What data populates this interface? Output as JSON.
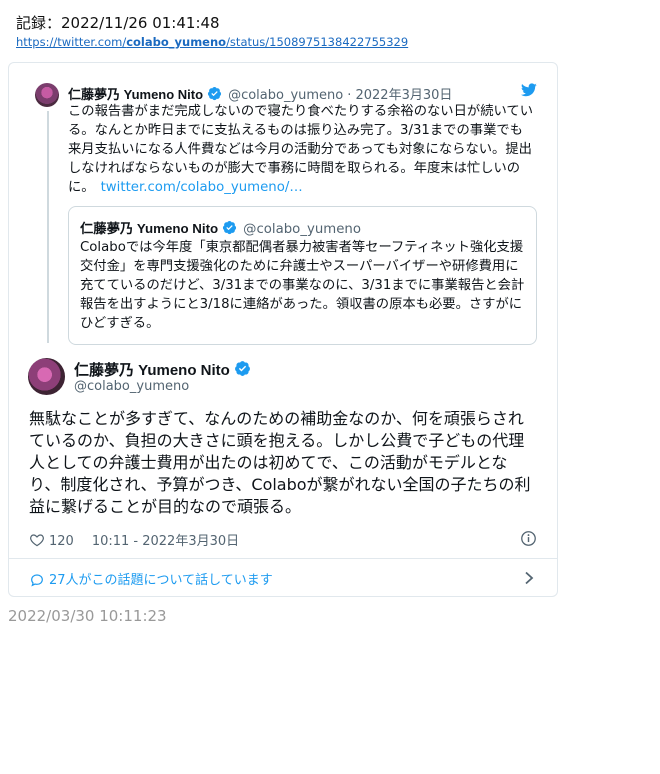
{
  "record": {
    "label": "記録：2022/11/26 01:41:48",
    "url_prefix": "https://twitter.com/",
    "url_user": "colabo_yumeno",
    "url_suffix": "/status/1508975138422755329"
  },
  "parent_tweet": {
    "name": "仁藤夢乃 Yumeno Nito",
    "handle": "@colabo_yumeno",
    "date": "· 2022年3月30日",
    "text": "この報告書がまだ完成しないので寝たり食べたりする余裕のない日が続いている。なんとか昨日までに支払えるものは振り込み完了。3/31までの事業でも来月支払いになる人件費などは今月の活動分であっても対象にならない。提出しなければならないものが膨大で事務に時間を取られる。年度末は忙しいのに。",
    "link": "twitter.com/colabo_yumeno/…"
  },
  "quoted_tweet": {
    "name": "仁藤夢乃 Yumeno Nito",
    "handle": "@colabo_yumeno",
    "text": "Colaboでは今年度「東京都配偶者暴力被害者等セーフティネット強化支援交付金」を専門支援強化のために弁護士やスーパーバイザーや研修費用に充てているのだけど、3/31までの事業なのに、3/31までに事業報告と会計報告を出すようにと3/18に連絡があった。領収書の原本も必要。さすがにひどすぎる。"
  },
  "main_tweet": {
    "name": "仁藤夢乃 Yumeno Nito",
    "handle": "@colabo_yumeno",
    "text": "無駄なことが多すぎて、なんのための補助金なのか、何を頑張らされているのか、負担の大きさに頭を抱える。しかし公費で子どもの代理人としての弁護士費用が出たのは初めてで、この活動がモデルとなり、制度化され、予算がつき、Colaboが繋がれない全国の子たちの利益に繋げることが目的なので頑張る。",
    "likes": "120",
    "timestamp": "10:11 - 2022年3月30日",
    "talking": "27人がこの話題について話しています"
  },
  "footer": {
    "timestamp": "2022/03/30 10:11:23"
  },
  "colors": {
    "link": "#1d9bf0",
    "verified": "#1d9bf0",
    "secondary_text": "#536471"
  },
  "icons": [
    "twitter-bird-icon",
    "verified-icon",
    "heart-icon",
    "info-icon",
    "speech-bubble-icon",
    "chevron-right-icon"
  ]
}
